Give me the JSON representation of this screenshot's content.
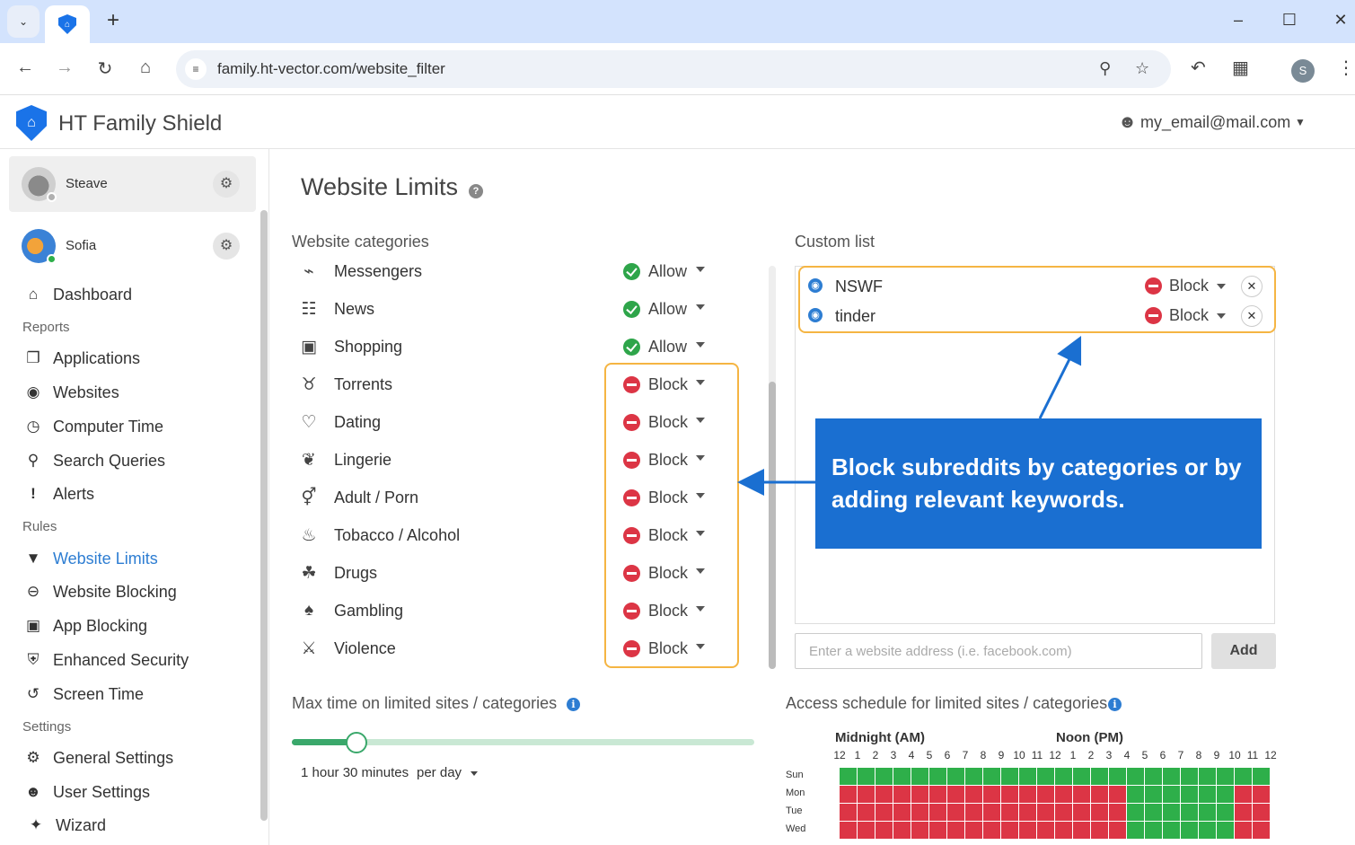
{
  "browser": {
    "url": "family.ht-vector.com/website_filter",
    "profile_initial": "S"
  },
  "app": {
    "name": "HT Family Shield",
    "user_email": "my_email@mail.com"
  },
  "children": [
    {
      "name": "Steave",
      "status_color": "#b0b0b0"
    },
    {
      "name": "Sofia",
      "status_color": "#2eaf4a"
    }
  ],
  "sidebar": {
    "dashboard": "Dashboard",
    "reports_label": "Reports",
    "reports": [
      "Applications",
      "Websites",
      "Computer Time",
      "Search Queries",
      "Alerts"
    ],
    "rules_label": "Rules",
    "rules": [
      "Website Limits",
      "Website Blocking",
      "App Blocking",
      "Enhanced Security",
      "Screen Time"
    ],
    "settings_label": "Settings",
    "settings": [
      "General Settings",
      "User Settings",
      "Wizard"
    ]
  },
  "page": {
    "title": "Website Limits",
    "categories_label": "Website categories",
    "custom_label": "Custom list"
  },
  "categories": [
    {
      "name": "Messengers",
      "status": "Allow",
      "icon": "messenger-icon"
    },
    {
      "name": "News",
      "status": "Allow",
      "icon": "newspaper-icon"
    },
    {
      "name": "Shopping",
      "status": "Allow",
      "icon": "shopping-bag-icon"
    },
    {
      "name": "Torrents",
      "status": "Block",
      "icon": "torrent-icon"
    },
    {
      "name": "Dating",
      "status": "Block",
      "icon": "dating-icon"
    },
    {
      "name": "Lingerie",
      "status": "Block",
      "icon": "lingerie-icon"
    },
    {
      "name": "Adult / Porn",
      "status": "Block",
      "icon": "gender-icon"
    },
    {
      "name": "Tobacco / Alcohol",
      "status": "Block",
      "icon": "cocktail-icon"
    },
    {
      "name": "Drugs",
      "status": "Block",
      "icon": "leaf-icon"
    },
    {
      "name": "Gambling",
      "status": "Block",
      "icon": "cards-icon"
    },
    {
      "name": "Violence",
      "status": "Block",
      "icon": "fight-icon"
    }
  ],
  "custom_list": [
    {
      "keyword": "NSWF",
      "status": "Block"
    },
    {
      "keyword": "tinder",
      "status": "Block"
    }
  ],
  "add_site": {
    "placeholder": "Enter a website address (i.e. facebook.com)",
    "button": "Add"
  },
  "callout": "Block subreddits by categories or by adding relevant keywords.",
  "max_time": {
    "label": "Max time on limited sites / categories",
    "value": "1 hour 30 minutes",
    "period": "per day",
    "slider_fraction": 0.14
  },
  "schedule": {
    "label": "Access schedule for limited sites / categories",
    "midnight_label": "Midnight (AM)",
    "noon_label": "Noon (PM)",
    "hours": [
      "12",
      "1",
      "2",
      "3",
      "4",
      "5",
      "6",
      "7",
      "8",
      "9",
      "10",
      "11",
      "12",
      "1",
      "2",
      "3",
      "4",
      "5",
      "6",
      "7",
      "8",
      "9",
      "10",
      "11",
      "12"
    ],
    "days": [
      "Sun",
      "Mon",
      "Tue",
      "Wed"
    ],
    "allowed_hours": [
      "GGGGGGGGGGGGGGGGGGGGGGGG",
      "RRRRRRRRRRRRRRRRGGGGGGRR",
      "RRRRRRRRRRRRRRRRGGGGGGRR",
      "RRRRRRRRRRRRRRRRGGGGGGRR"
    ]
  },
  "colors": {
    "accent": "#2d7dd2",
    "allow": "#2ea54a",
    "block": "#dc3545",
    "highlight": "#f5b543",
    "callout": "#1a6fd1"
  }
}
